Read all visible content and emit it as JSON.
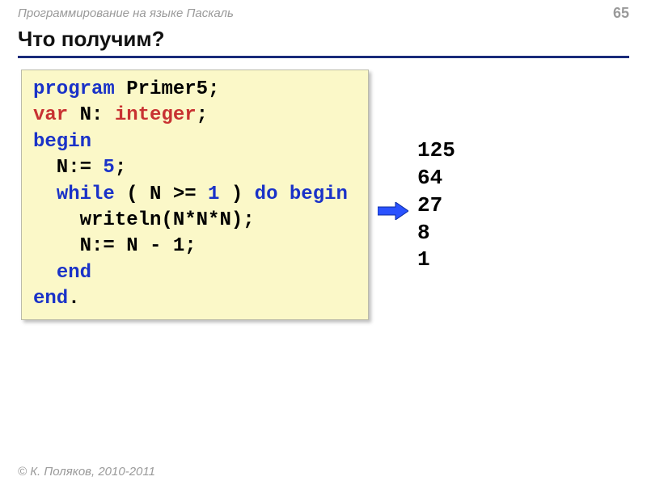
{
  "header": {
    "course": "Программирование на языке Паскаль",
    "page_number": "65"
  },
  "title": "Что получим?",
  "code": {
    "l1_program": "program",
    "l1_name": " Primer5;",
    "l2_var": "var",
    "l2_n": " N: ",
    "l2_type": "integer",
    "l2_semi": ";",
    "l3_begin": "begin",
    "l4_indent": "  N:= ",
    "l4_num": "5",
    "l4_semi": ";",
    "l5_indent": "  ",
    "l5_while": "while",
    "l5_cond1": " ( N >= ",
    "l5_num": "1",
    "l5_cond2": " ) ",
    "l5_do": "do",
    "l5_sp": " ",
    "l5_begin": "begin",
    "l6": "    writeln(N*N*N);",
    "l7": "    N:= N - 1;",
    "l8_indent": "  ",
    "l8_end": "end",
    "l9_end": "end",
    "l9_dot": "."
  },
  "output": {
    "lines": "125\n64\n27\n8\n1"
  },
  "footer": "© К. Поляков, 2010-2011"
}
